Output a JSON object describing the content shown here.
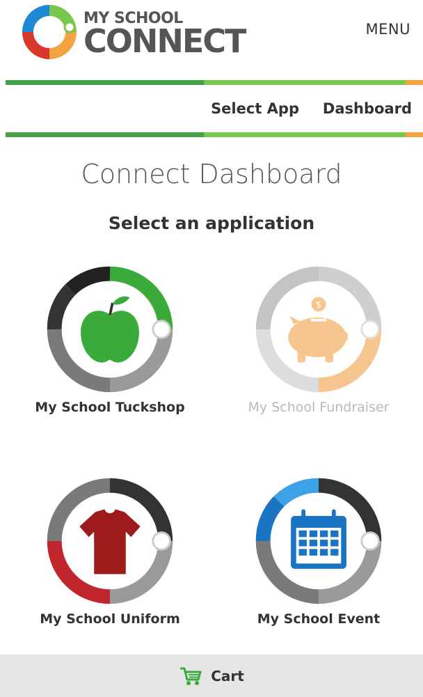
{
  "header": {
    "logo_top": "MY SCHOOL",
    "logo_bottom": "CONNECT",
    "menu_label": "MENU"
  },
  "nav": {
    "select_app": "Select App",
    "dashboard": "Dashboard"
  },
  "main": {
    "title": "Connect Dashboard",
    "subtitle": "Select an application"
  },
  "apps": [
    {
      "label": "My School Tuckshop",
      "icon": "apple-icon",
      "color": "#3aab3a",
      "enabled": true
    },
    {
      "label": "My School Fundraiser",
      "icon": "piggy-bank-icon",
      "color": "#f7c58e",
      "enabled": false
    },
    {
      "label": "My School Uniform",
      "icon": "tshirt-icon",
      "color": "#9e1b1b",
      "enabled": true
    },
    {
      "label": "My School Event",
      "icon": "calendar-icon",
      "color": "#1a74c4",
      "enabled": true
    }
  ],
  "footer": {
    "cart_label": "Cart",
    "cart_icon": "cart-icon"
  },
  "colors": {
    "stripe_dark_green": "#43a047",
    "stripe_light_green": "#7ac74f",
    "stripe_orange": "#f4a340"
  }
}
